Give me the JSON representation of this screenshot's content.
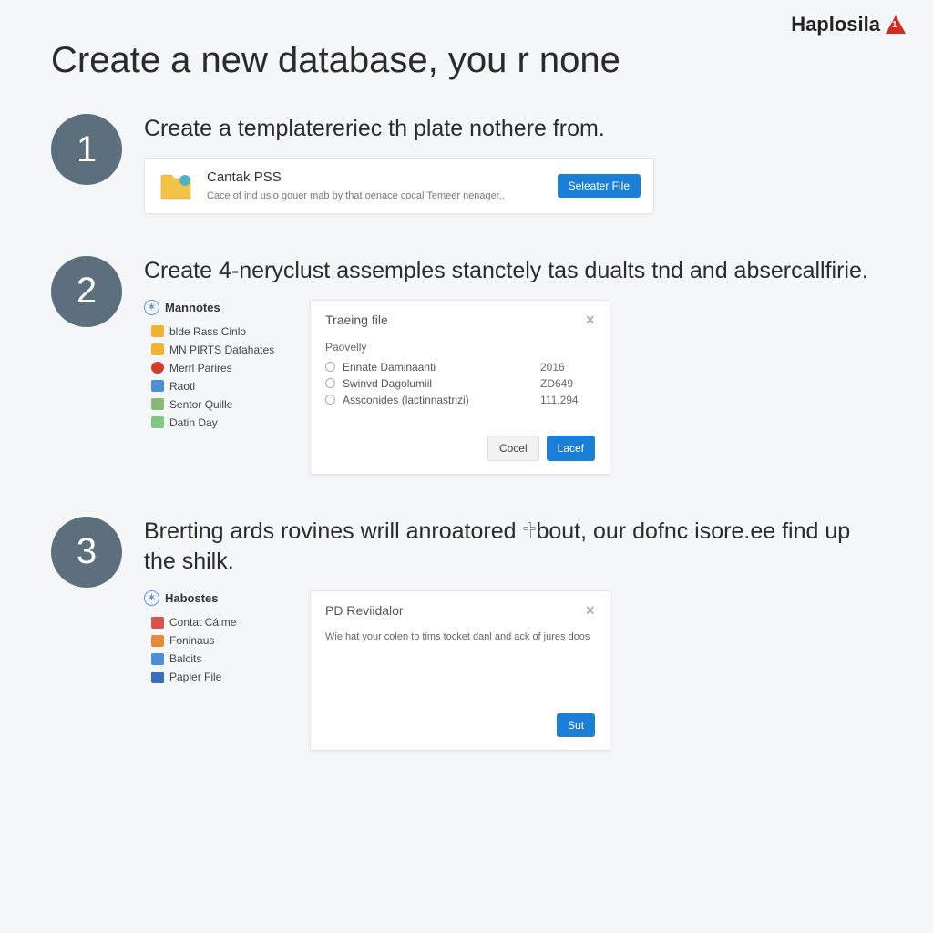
{
  "brand": {
    "name": "Haplosila"
  },
  "page": {
    "title": "Create a new database, you r none"
  },
  "steps": [
    {
      "number": "1",
      "heading": "Create a templatereriec th plate nothere from.",
      "card": {
        "title": "Cantak PSS",
        "description": "Cace of ind uslo gouer mab by that oenace cocal Temeer nenager..",
        "button": "Seleater File"
      }
    },
    {
      "number": "2",
      "heading": "Create 4-neryclust assemples stanctely tas dualts tnd and abserсallfirie.",
      "tree": {
        "header": "Mannotes",
        "items": [
          {
            "icon": "folder",
            "label": "blde Rass Cinlo"
          },
          {
            "icon": "folder",
            "label": "MN PIRTS Datahates"
          },
          {
            "icon": "red",
            "label": "Merrl Parires"
          },
          {
            "icon": "blue",
            "label": "Raotl"
          },
          {
            "icon": "teal",
            "label": "Sentor Quille"
          },
          {
            "icon": "green",
            "label": "Datin Day"
          }
        ]
      },
      "dialog": {
        "title": "Traeing file",
        "section": "Paovelly",
        "options": [
          {
            "label": "Ennate Daminaanti",
            "value": "2016"
          },
          {
            "label": "Swinvd Dagolumiil",
            "value": "ZD649"
          },
          {
            "label": "Assconides (lactinnastrizi)",
            "value": "111,294"
          }
        ],
        "cancel": "Cocel",
        "confirm": "Lacef"
      }
    },
    {
      "number": "3",
      "heading": "Brerting ards rovines wrill anroatored 🕆bout, our dofnc isore.ee find up the shilk.",
      "tree": {
        "header": "Habostes",
        "items": [
          {
            "icon": "redbox",
            "label": "Contat Cáime"
          },
          {
            "icon": "orange",
            "label": "Foninaus"
          },
          {
            "icon": "blue",
            "label": "Balcits"
          },
          {
            "icon": "bluebox",
            "label": "Papler File"
          }
        ]
      },
      "dialog": {
        "title": "PD Reviidalor",
        "body": "Wie hat your colen to tims tocket danl and ack of jures doos",
        "confirm": "Sut"
      }
    }
  ]
}
